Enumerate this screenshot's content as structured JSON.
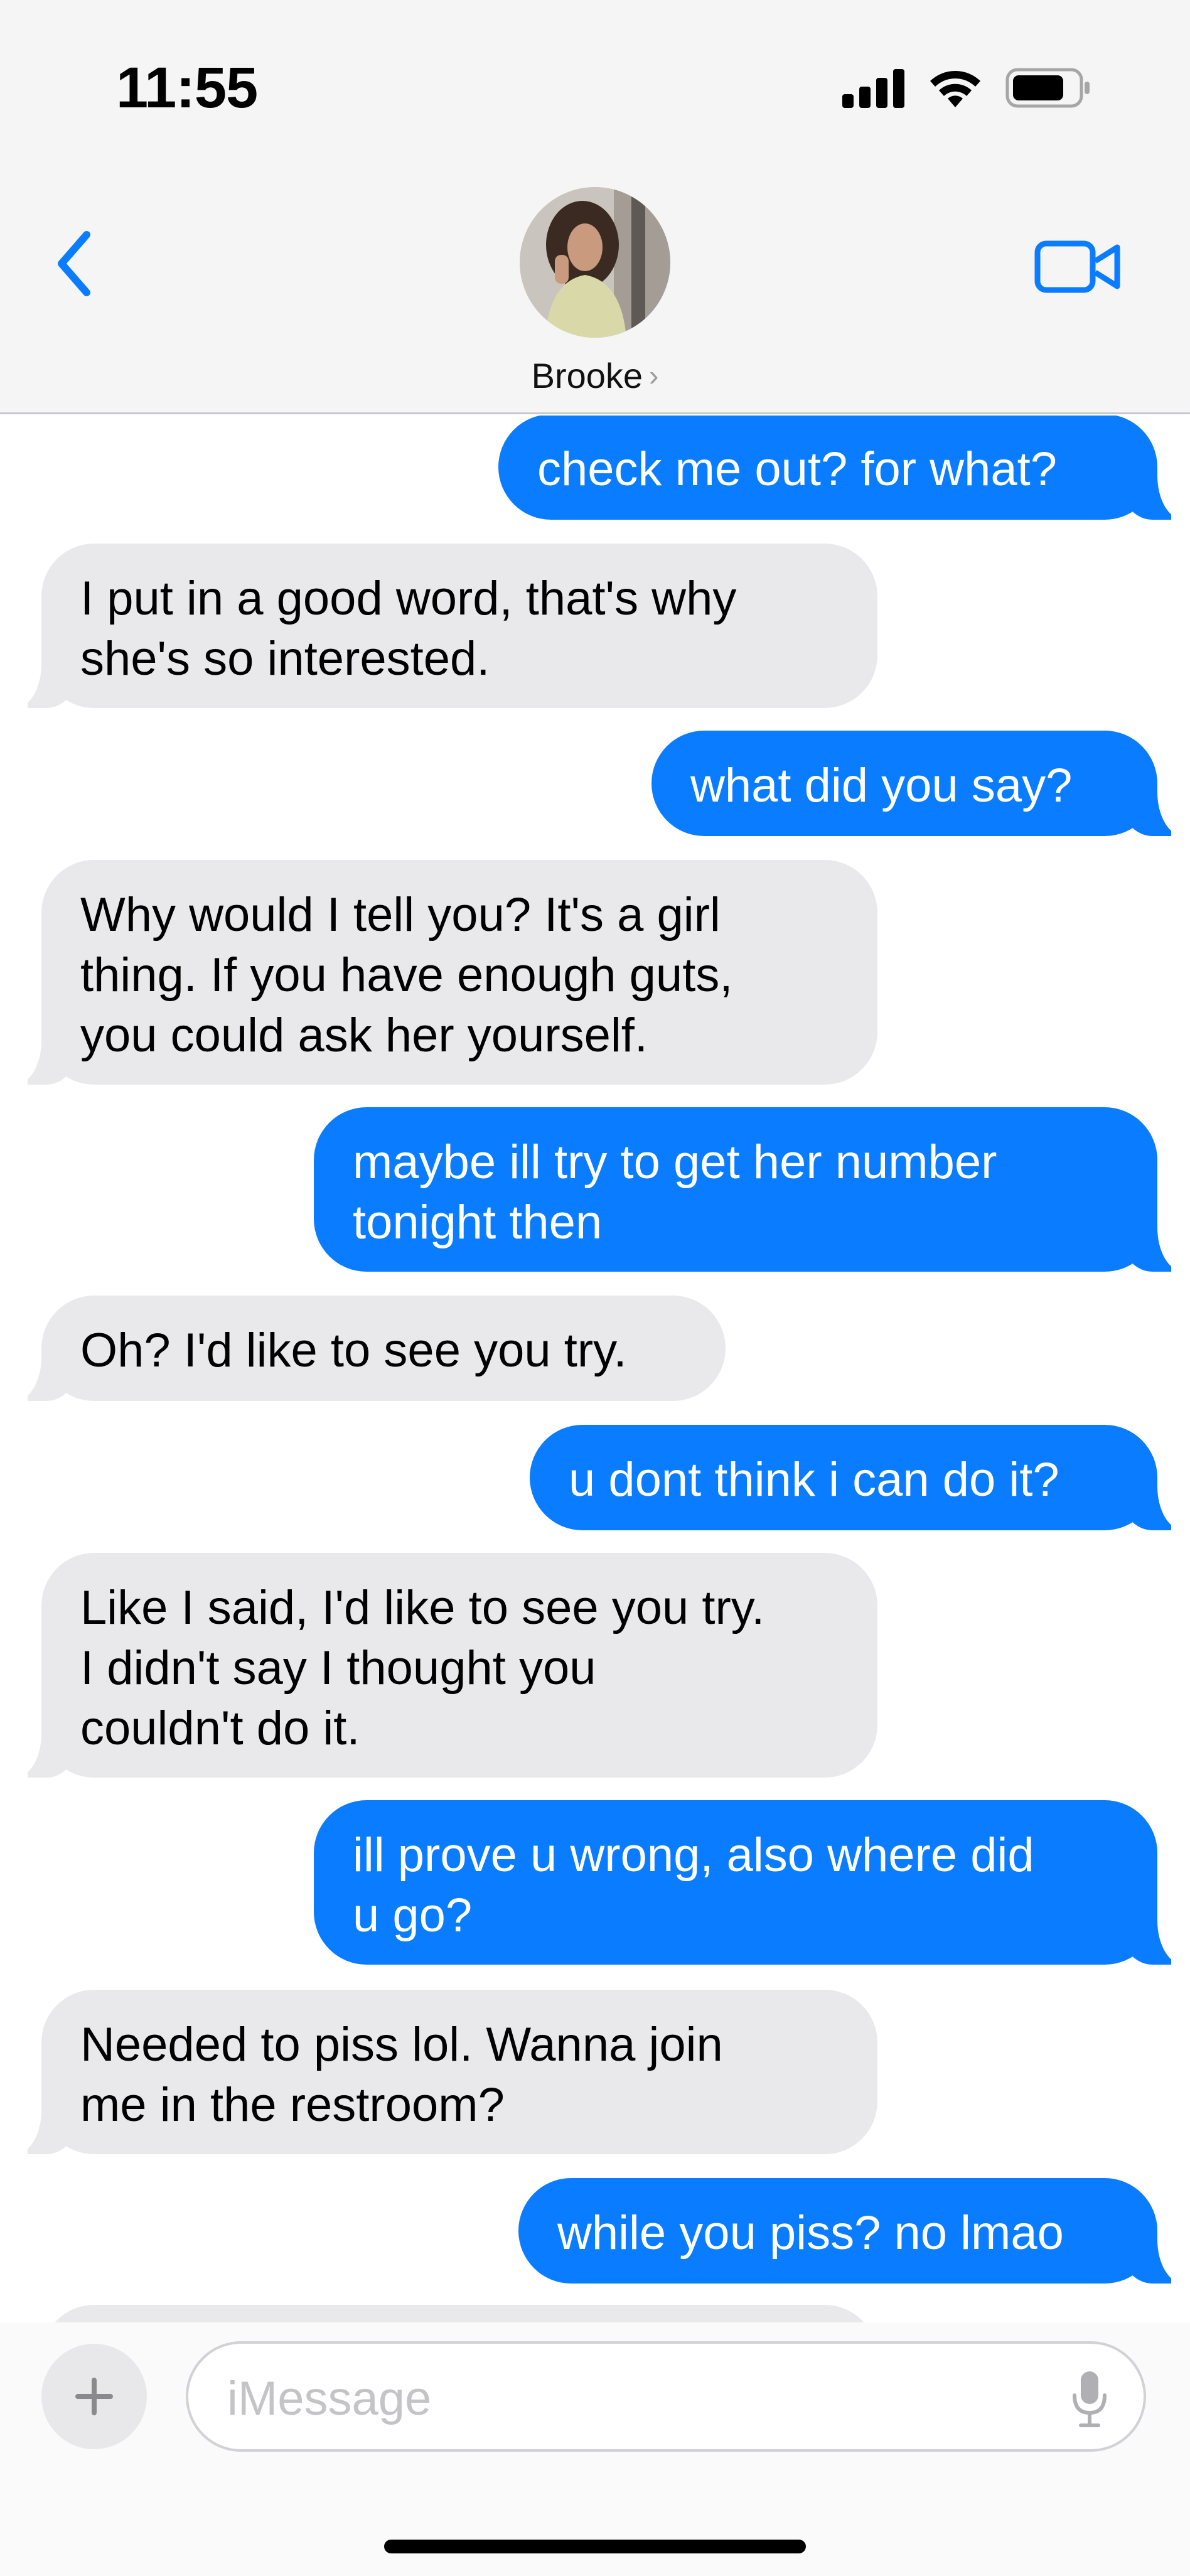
{
  "status_bar": {
    "time": "11:55",
    "icons": [
      "cellular-signal-icon",
      "wifi-icon",
      "battery-icon"
    ]
  },
  "header": {
    "back_icon": "chevron-left-icon",
    "video_icon": "video-camera-icon",
    "contact_name": "Brooke",
    "contact_chevron": "›"
  },
  "messages": [
    {
      "from": "me",
      "text": "check me out? for what?"
    },
    {
      "from": "them",
      "text": "I put in a good word, that's why\nshe's so interested."
    },
    {
      "from": "me",
      "text": "what did you say?"
    },
    {
      "from": "them",
      "text": "Why would I tell you? It's a girl\nthing. If you have enough guts,\nyou could ask her yourself."
    },
    {
      "from": "me",
      "text": "maybe ill try to get her number\ntonight then"
    },
    {
      "from": "them",
      "text": "Oh? I'd like to see you try."
    },
    {
      "from": "me",
      "text": "u dont think i can do it?"
    },
    {
      "from": "them",
      "text": "Like I said, I'd like to see you try.\nI didn't say I thought you\ncouldn't do it."
    },
    {
      "from": "me",
      "text": "ill prove u wrong, also where did\nu go?"
    },
    {
      "from": "them",
      "text": "Needed to piss lol. Wanna join\nme in the restroom?"
    },
    {
      "from": "me",
      "text": "while you piss? no lmao"
    },
    {
      "from": "them",
      "text": ""
    }
  ],
  "composer": {
    "placeholder": "iMessage",
    "plus_icon": "plus-icon",
    "mic_icon": "microphone-icon"
  },
  "colors": {
    "sent_bubble": "#0a7cff",
    "received_bubble": "#e9e9eb",
    "accent": "#0a7cff"
  }
}
